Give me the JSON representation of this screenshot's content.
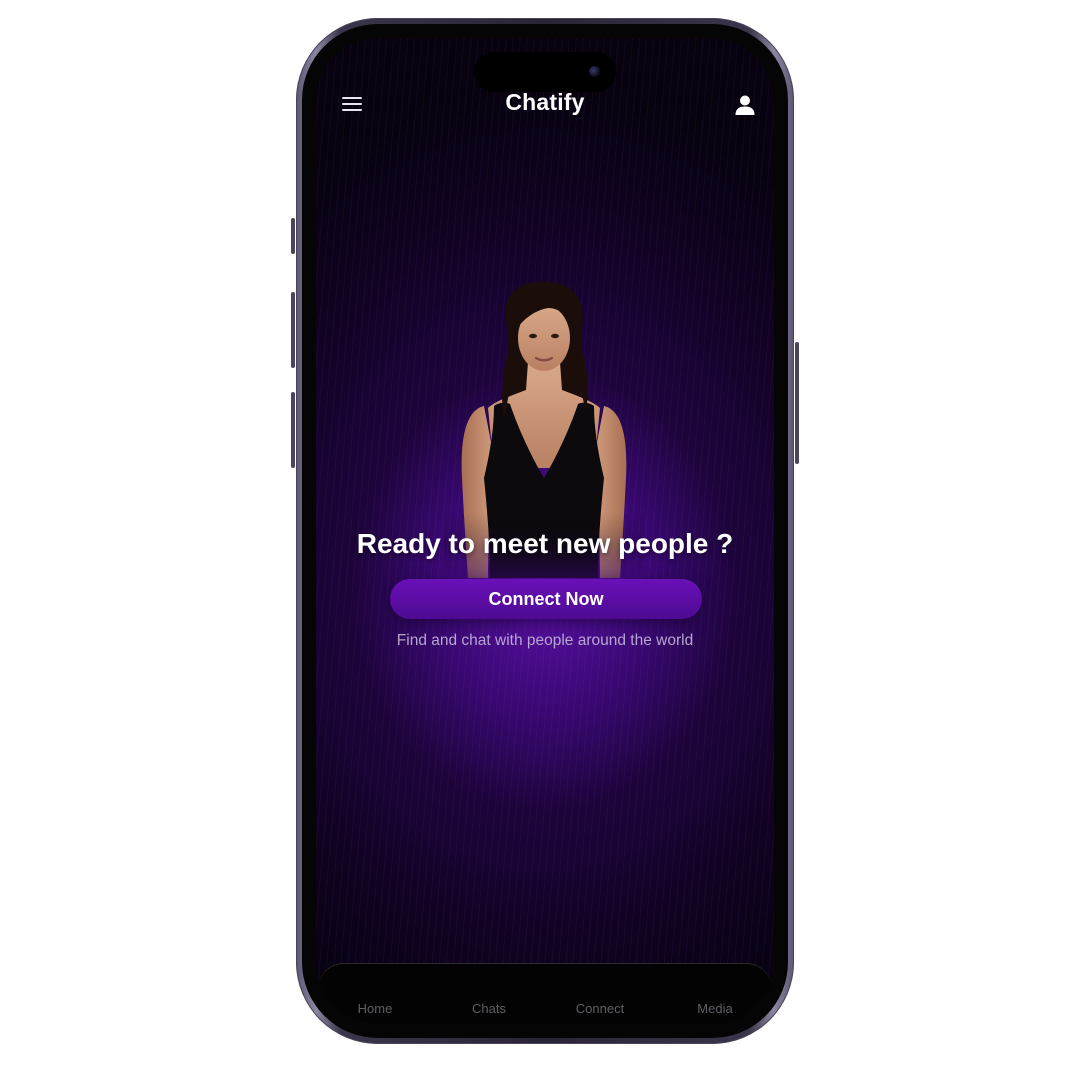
{
  "header": {
    "app_title": "Chatify"
  },
  "hero": {
    "headline": "Ready to meet new people ?",
    "cta_label": "Connect Now",
    "subtitle": "Find and chat with people around the world"
  },
  "bottom_nav": {
    "items": [
      {
        "label": "Home"
      },
      {
        "label": "Chats"
      },
      {
        "label": "Connect"
      },
      {
        "label": "Media"
      }
    ]
  },
  "icons": {
    "menu": "hamburger-menu-icon",
    "profile": "user-icon"
  },
  "colors": {
    "accent": "#5a0ca6",
    "background": "#1a0436",
    "text_primary": "#ffffff",
    "text_secondary": "#b7a6cf",
    "nav_text": "#5f5f66"
  }
}
